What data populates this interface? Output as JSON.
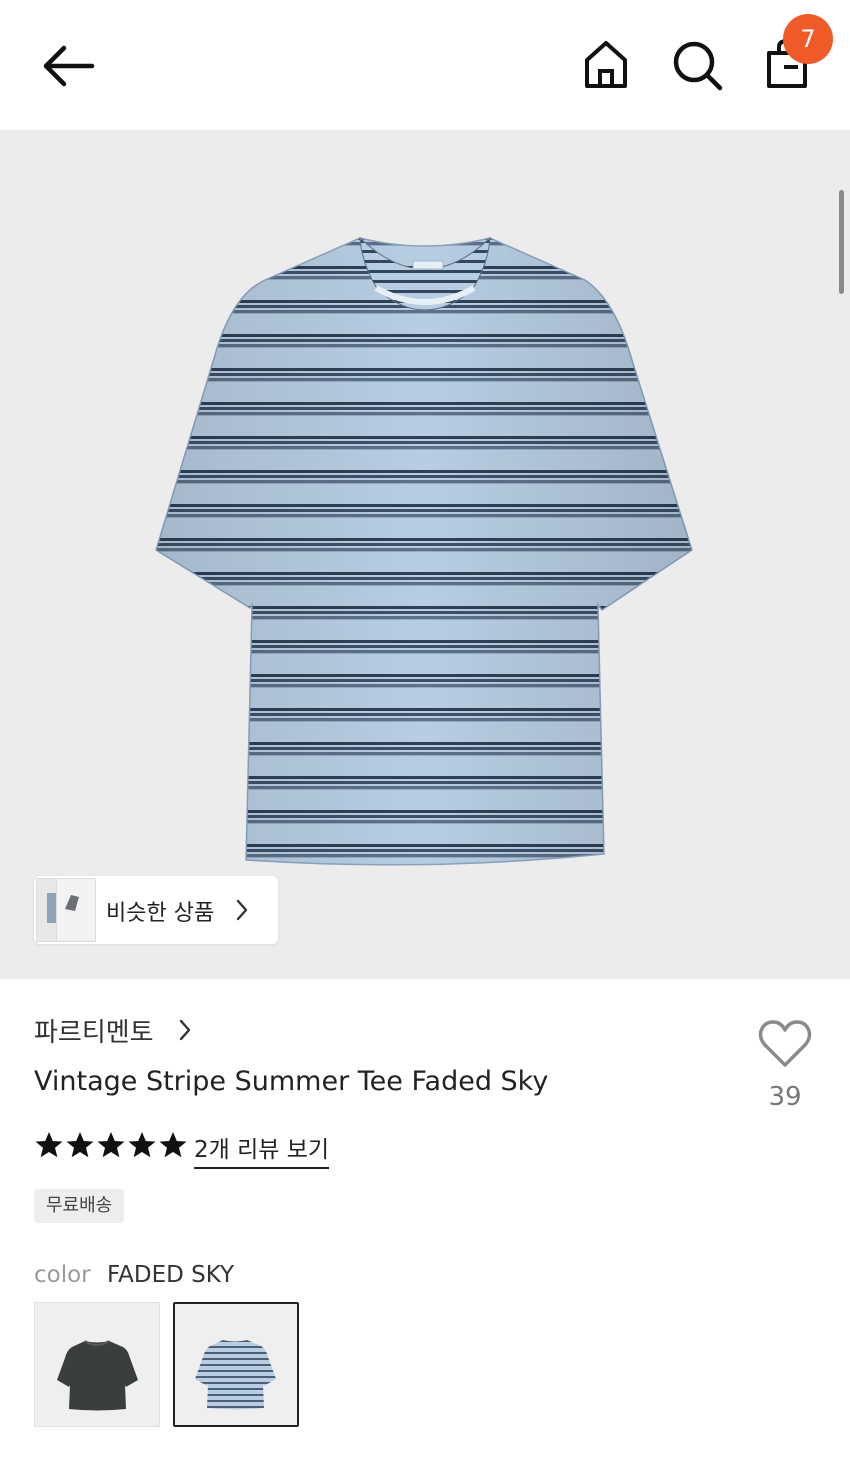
{
  "header": {
    "back_icon": "back-arrow-icon",
    "home_icon": "home-icon",
    "search_icon": "search-icon",
    "cart_icon": "shopping-bag-icon",
    "cart_count": "7"
  },
  "hero": {
    "similar_label": "비슷한 상품",
    "similar_icon": "chevron-right-icon"
  },
  "product": {
    "brand": "파르티멘토",
    "title": "Vintage Stripe Summer Tee Faded Sky",
    "likes": "39",
    "rating_stars": 5,
    "reviews_link": "2개 리뷰 보기",
    "shipping_tag": "무료배송",
    "color_label": "color",
    "color_value": "FADED SKY"
  },
  "colors": {
    "accent": "#f05a28",
    "stripe_light": "#aec6de",
    "stripe_dark": "#2f3f55",
    "charcoal": "#3a3e3e"
  }
}
